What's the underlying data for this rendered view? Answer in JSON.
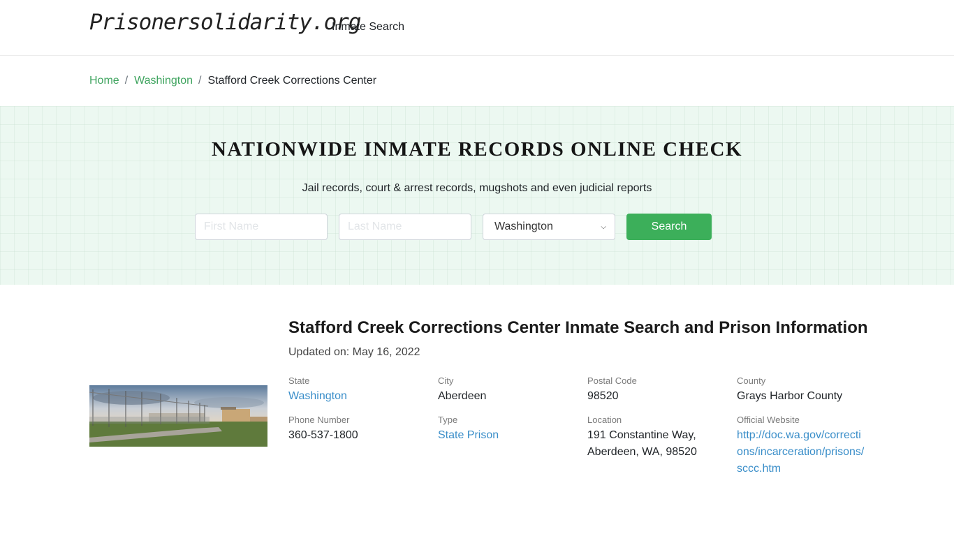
{
  "navbar": {
    "logo": "Prisonersolidarity.org",
    "links": [
      "Inmate Search"
    ]
  },
  "breadcrumb": {
    "items": [
      "Home",
      "Washington"
    ],
    "separator": "/",
    "current": "Stafford Creek Corrections Center"
  },
  "banner": {
    "title": "NATIONWIDE INMATE RECORDS ONLINE CHECK",
    "subtitle": "Jail records, court & arrest records, mugshots and even judicial reports",
    "first_name_placeholder": "First Name",
    "last_name_placeholder": "Last Name",
    "state_selected": "Washington",
    "search_label": "Search",
    "accent_color": "#3caf5a"
  },
  "facility": {
    "title": "Stafford Creek Corrections Center Inmate Search and Prison Information",
    "updated": "Updated on: May 16, 2022",
    "photo_alt": "Stafford Creek Corrections Center perimeter fence",
    "fields": {
      "state": {
        "label": "State",
        "value": "Washington"
      },
      "city": {
        "label": "City",
        "value": "Aberdeen"
      },
      "postal": {
        "label": "Postal Code",
        "value": "98520"
      },
      "county": {
        "label": "County",
        "value": "Grays Harbor County"
      },
      "phone": {
        "label": "Phone Number",
        "value": "360-537-1800"
      },
      "type": {
        "label": "Type",
        "value": "State Prison"
      },
      "location": {
        "label": "Location",
        "value": "191 Constantine Way, Aberdeen, WA, 98520"
      },
      "website": {
        "label": "Official Website",
        "value": "http://doc.wa.gov/corrections/incarceration/prisons/sccc.htm"
      }
    }
  }
}
